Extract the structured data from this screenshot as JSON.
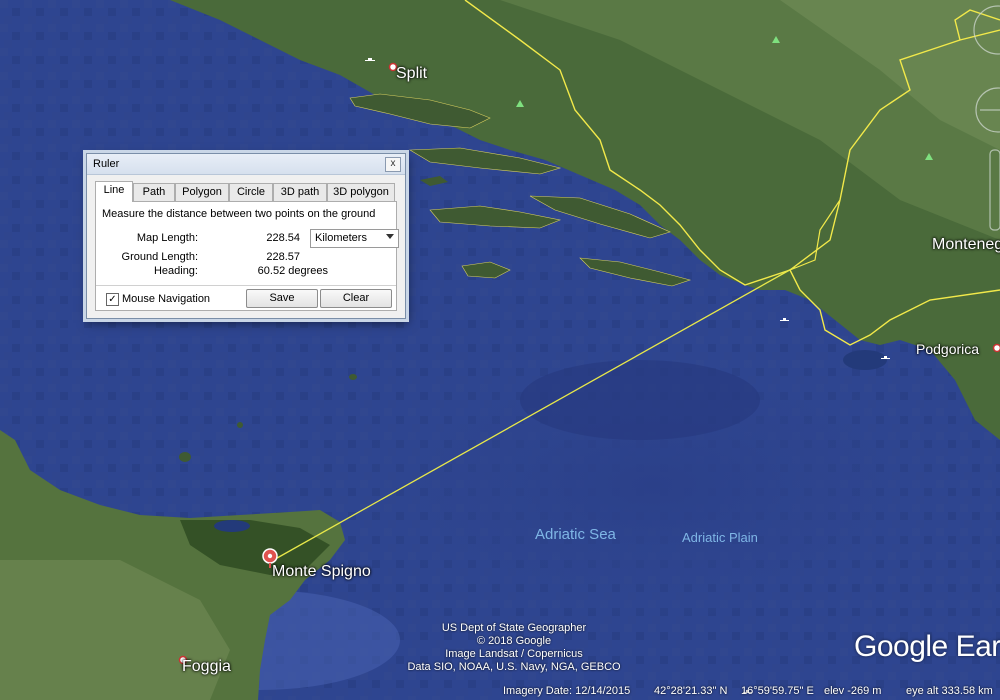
{
  "map": {
    "places": [
      {
        "name": "Split"
      },
      {
        "name": "Montenegro"
      },
      {
        "name": "Podgorica"
      },
      {
        "name": "Monte Spigno"
      },
      {
        "name": "Foggia"
      }
    ],
    "water_labels": [
      "Adriatic Sea",
      "Adriatic Plain"
    ],
    "attribution": [
      "US Dept of State Geographer",
      "© 2018 Google",
      "Image Landsat / Copernicus",
      "Data SIO, NOAA, U.S. Navy, NGA, GEBCO"
    ],
    "brand": "Google Earth",
    "measure_line_color": "#e8e84a",
    "border_color": "#f2e94a"
  },
  "ruler": {
    "title": "Ruler",
    "close_label": "x",
    "tabs": [
      "Line",
      "Path",
      "Polygon",
      "Circle",
      "3D path",
      "3D polygon"
    ],
    "active_tab": "Line",
    "description": "Measure the distance between two points on the ground",
    "map_length_label": "Map Length:",
    "map_length_value": "228.54",
    "unit_selected": "Kilometers",
    "ground_length_label": "Ground Length:",
    "ground_length_value": "228.57",
    "heading_label": "Heading:",
    "heading_value": "60.52 degrees",
    "mouse_nav_label": "Mouse Navigation",
    "mouse_nav_checked": true,
    "check_mark": "✓",
    "save_label": "Save",
    "clear_label": "Clear"
  },
  "status": {
    "imagery_date": "Imagery Date: 12/14/2015",
    "lat": "42°28'21.33\" N",
    "lon": "16°59'59.75\" E",
    "elev": "elev  -269 m",
    "eye_alt": "eye alt 333.58 km"
  }
}
